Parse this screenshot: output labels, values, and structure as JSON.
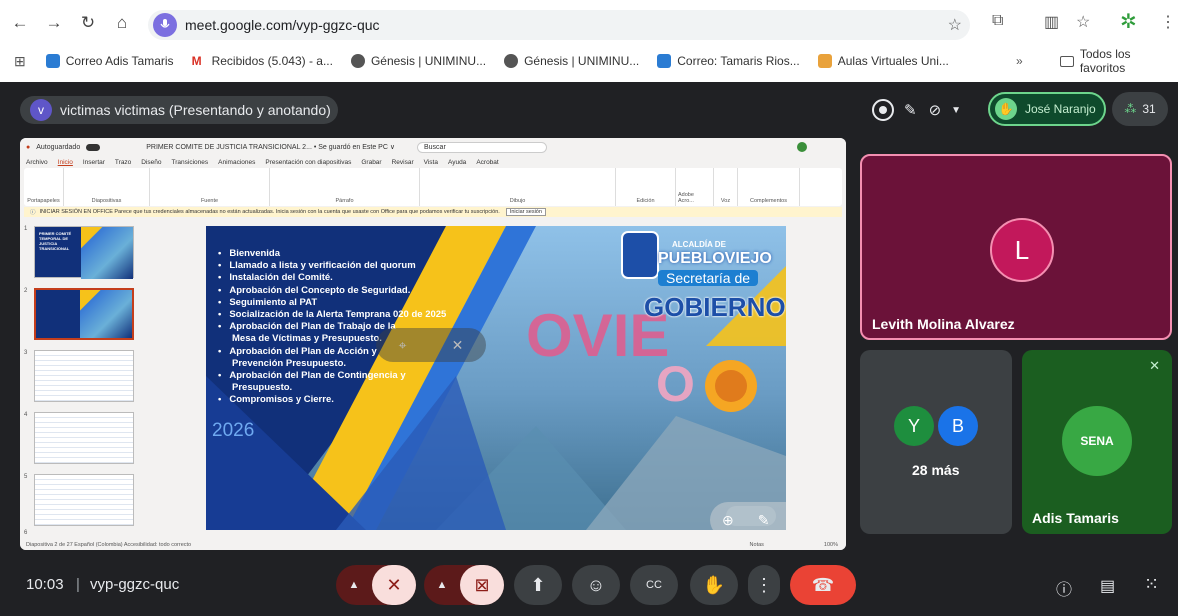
{
  "browser": {
    "url": "meet.google.com/vyp-ggzc-quc",
    "bookmarks": [
      "Correo Adis Tamaris",
      "Recibidos (5.043) - a...",
      "Génesis | UNIMINU...",
      "Génesis | UNIMINU...",
      "Correo: Tamaris Rios...",
      "Aulas Virtuales Uni..."
    ],
    "more": "»",
    "all_favorites": "Todos los favoritos"
  },
  "presenter": {
    "initial": "v",
    "label": "victimas victimas (Presentando y anotando)"
  },
  "hand": {
    "name": "José Naranjo"
  },
  "participants_count": "31",
  "ppt": {
    "title": "PRIMER COMITE DE JUSTICIA TRANSICIONAL 2... • Se guardó en Este PC ∨",
    "autosave": "Autoguardado",
    "search": "Buscar",
    "menu": [
      "Archivo",
      "Inicio",
      "Insertar",
      "Trazo",
      "Diseño",
      "Transiciones",
      "Animaciones",
      "Presentación con diapositivas",
      "Grabar",
      "Revisar",
      "Vista",
      "Ayuda",
      "Acrobat"
    ],
    "groups": [
      "Portapapeles",
      "Diapositivas",
      "Fuente",
      "Párrafo",
      "Dibujo",
      "Edición",
      "Adobe Acro...",
      "Voz",
      "Complementos"
    ],
    "notification": "INICIAR SESIÓN EN OFFICE  Parece que tus credenciales almacenadas no están actualizadas. Inicia sesión con la cuenta que usaste con Office para que podamos verificar tu suscripción.",
    "notif_btn": "Iniciar sesión",
    "status": "Diapositiva 2 de 27    Español (Colombia)    Accesibilidad: todo correcto",
    "notes": "Notas",
    "zoom": "100%",
    "thumb_numbers": [
      "1",
      "2",
      "3",
      "4",
      "5",
      "6"
    ],
    "thumb1_title": "PRIMER COMITÉ TEMPORAL DE JUSTICIA TRANSICIONAL"
  },
  "slide": {
    "items": [
      "Bienvenida",
      "Llamado a lista y verificación del quorum",
      "Instalación del Comité.",
      "Aprobación del Concepto de Seguridad.",
      "Seguimiento al PAT",
      "Socialización de la Alerta Temprana 020 de 2025",
      "Aprobación del Plan de Trabajo de la Mesa de Víctimas y Presupuesto.",
      "Aprobación del Plan de Acción y Prevención Presupuesto.",
      "Aprobación del Plan de Contingencia y Presupuesto.",
      "Compromisos y Cierre."
    ],
    "year": "2026",
    "alcaldia": "ALCALDÍA DE",
    "pueblo": "PUEBLOVIEJO",
    "secretaria": "Secretaría de",
    "gobierno": "GOBIERNO"
  },
  "tiles": {
    "levith_initial": "L",
    "levith": "Levith Molina Alvarez",
    "y": "Y",
    "b": "B",
    "more": "28 más",
    "adis": "Adis Tamaris",
    "sena": "SENA"
  },
  "bottom": {
    "time": "10:03",
    "sep": "|",
    "code": "vyp-ggzc-quc"
  },
  "colors": {
    "accent": "#8ab4f8",
    "end_call": "#ea4335",
    "muted": "#f9dedc",
    "pink": "#c2185b"
  }
}
